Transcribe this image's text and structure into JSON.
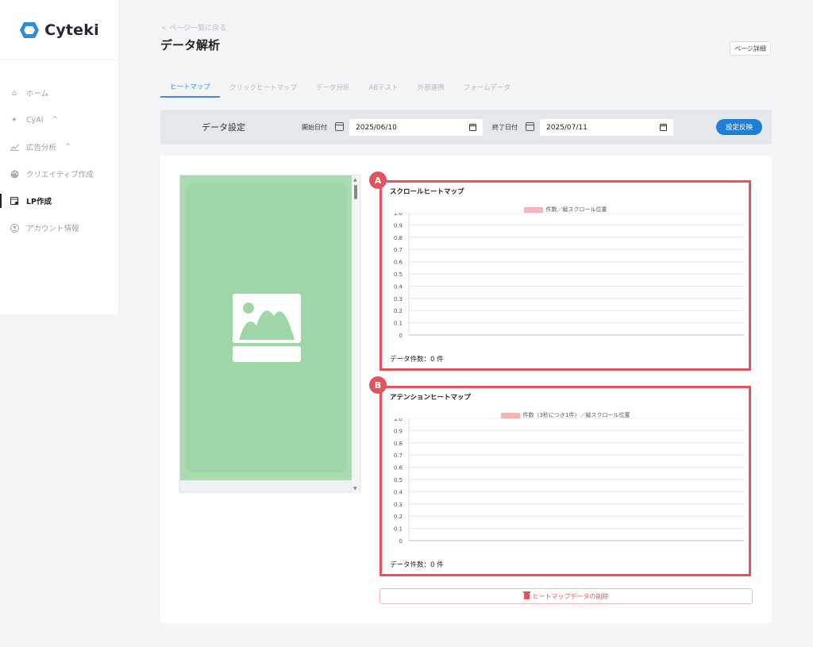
{
  "app": {
    "logo_text": "Cyteki",
    "accent": "#3a8fd8",
    "brand": "#1f7fd6",
    "highlight": "#e0545c"
  },
  "sidebar": {
    "items": [
      {
        "label": "ホーム",
        "icon": "home-icon"
      },
      {
        "label": "CyAI",
        "icon": "sparkle-icon",
        "caret": "^"
      },
      {
        "label": "広告分析",
        "icon": "chart-line-icon",
        "caret": "^"
      },
      {
        "label": "クリエイティブ作成",
        "icon": "palette-icon"
      },
      {
        "label": "LP作成",
        "icon": "lp-icon",
        "active": true
      },
      {
        "label": "アカウント情報",
        "icon": "account-icon"
      }
    ]
  },
  "header": {
    "back_link": "ページ一覧に戻る",
    "back_glyph": "<",
    "title": "データ解析",
    "detail_button": "ページ詳細"
  },
  "tabs": [
    {
      "label": "ヒートマップ",
      "active": true
    },
    {
      "label": "クリックヒートマップ"
    },
    {
      "label": "データ分析"
    },
    {
      "label": "ABテスト"
    },
    {
      "label": "外部連携"
    },
    {
      "label": "フォームデータ"
    }
  ],
  "settings": {
    "label": "データ設定",
    "start_label": "開始日付",
    "start_value": "2025/06/10",
    "end_label": "終了日付",
    "end_value": "2025/07/11",
    "apply_button": "設定反映"
  },
  "panels": {
    "a": {
      "badge": "A",
      "title": "スクロールヒートマップ",
      "legend": "件数／縦スクロール位置",
      "count": "データ件数：0 件"
    },
    "b": {
      "badge": "B",
      "title": "アテンションヒートマップ",
      "legend": "件数（3秒につき1件）／縦スクロール位置",
      "count": "データ件数：0 件"
    }
  },
  "chart_data": [
    {
      "type": "bar",
      "title": "スクロールヒートマップ",
      "series": [
        {
          "name": "件数／縦スクロール位置",
          "values": []
        }
      ],
      "ylim": [
        0,
        1.0
      ],
      "yticks": [
        "1.0",
        "0.9",
        "0.8",
        "0.7",
        "0.6",
        "0.5",
        "0.4",
        "0.3",
        "0.2",
        "0.1",
        "0"
      ],
      "grid": true,
      "legend": "top-center"
    },
    {
      "type": "bar",
      "title": "アテンションヒートマップ",
      "series": [
        {
          "name": "件数（3秒につき1件）／縦スクロール位置",
          "values": []
        }
      ],
      "ylim": [
        0,
        1.0
      ],
      "yticks": [
        "1.0",
        "0.9",
        "0.8",
        "0.7",
        "0.6",
        "0.5",
        "0.4",
        "0.3",
        "0.2",
        "0.1",
        "0"
      ],
      "grid": true,
      "legend": "top-center"
    }
  ],
  "delete_button": "ヒートマップデータの削除"
}
